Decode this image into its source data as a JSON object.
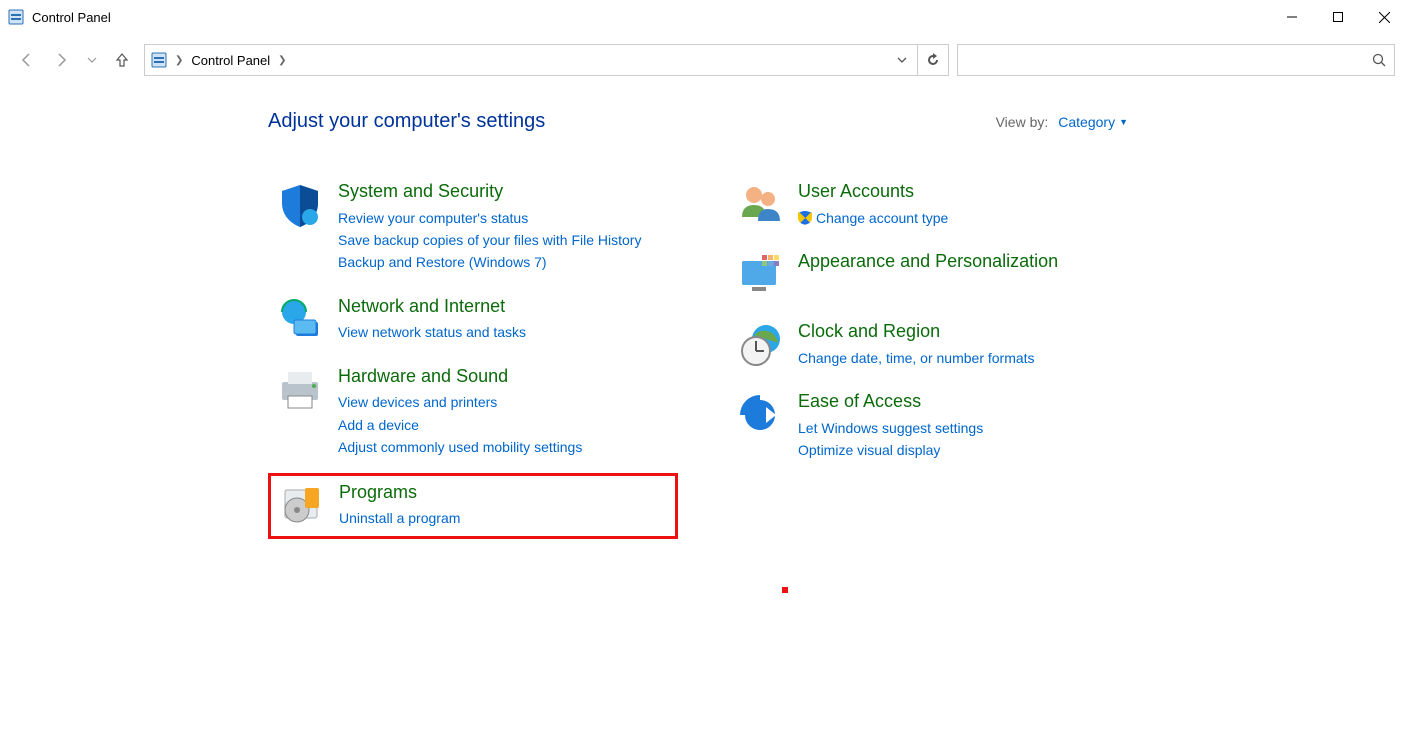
{
  "window": {
    "title": "Control Panel"
  },
  "breadcrumb": {
    "root": "Control Panel"
  },
  "heading": "Adjust your computer's settings",
  "viewby": {
    "label": "View by:",
    "value": "Category"
  },
  "left": [
    {
      "id": "system-security",
      "title": "System and Security",
      "links": [
        "Review your computer's status",
        "Save backup copies of your files with File History",
        "Backup and Restore (Windows 7)"
      ]
    },
    {
      "id": "network-internet",
      "title": "Network and Internet",
      "links": [
        "View network status and tasks"
      ]
    },
    {
      "id": "hardware-sound",
      "title": "Hardware and Sound",
      "links": [
        "View devices and printers",
        "Add a device",
        "Adjust commonly used mobility settings"
      ]
    },
    {
      "id": "programs",
      "title": "Programs",
      "links": [
        "Uninstall a program"
      ],
      "highlighted": true
    }
  ],
  "right": [
    {
      "id": "user-accounts",
      "title": "User Accounts",
      "links": [
        {
          "text": "Change account type",
          "shield": true
        }
      ]
    },
    {
      "id": "appearance",
      "title": "Appearance and Personalization",
      "links": []
    },
    {
      "id": "clock-region",
      "title": "Clock and Region",
      "links": [
        "Change date, time, or number formats"
      ]
    },
    {
      "id": "ease-of-access",
      "title": "Ease of Access",
      "links": [
        "Let Windows suggest settings",
        "Optimize visual display"
      ]
    }
  ]
}
